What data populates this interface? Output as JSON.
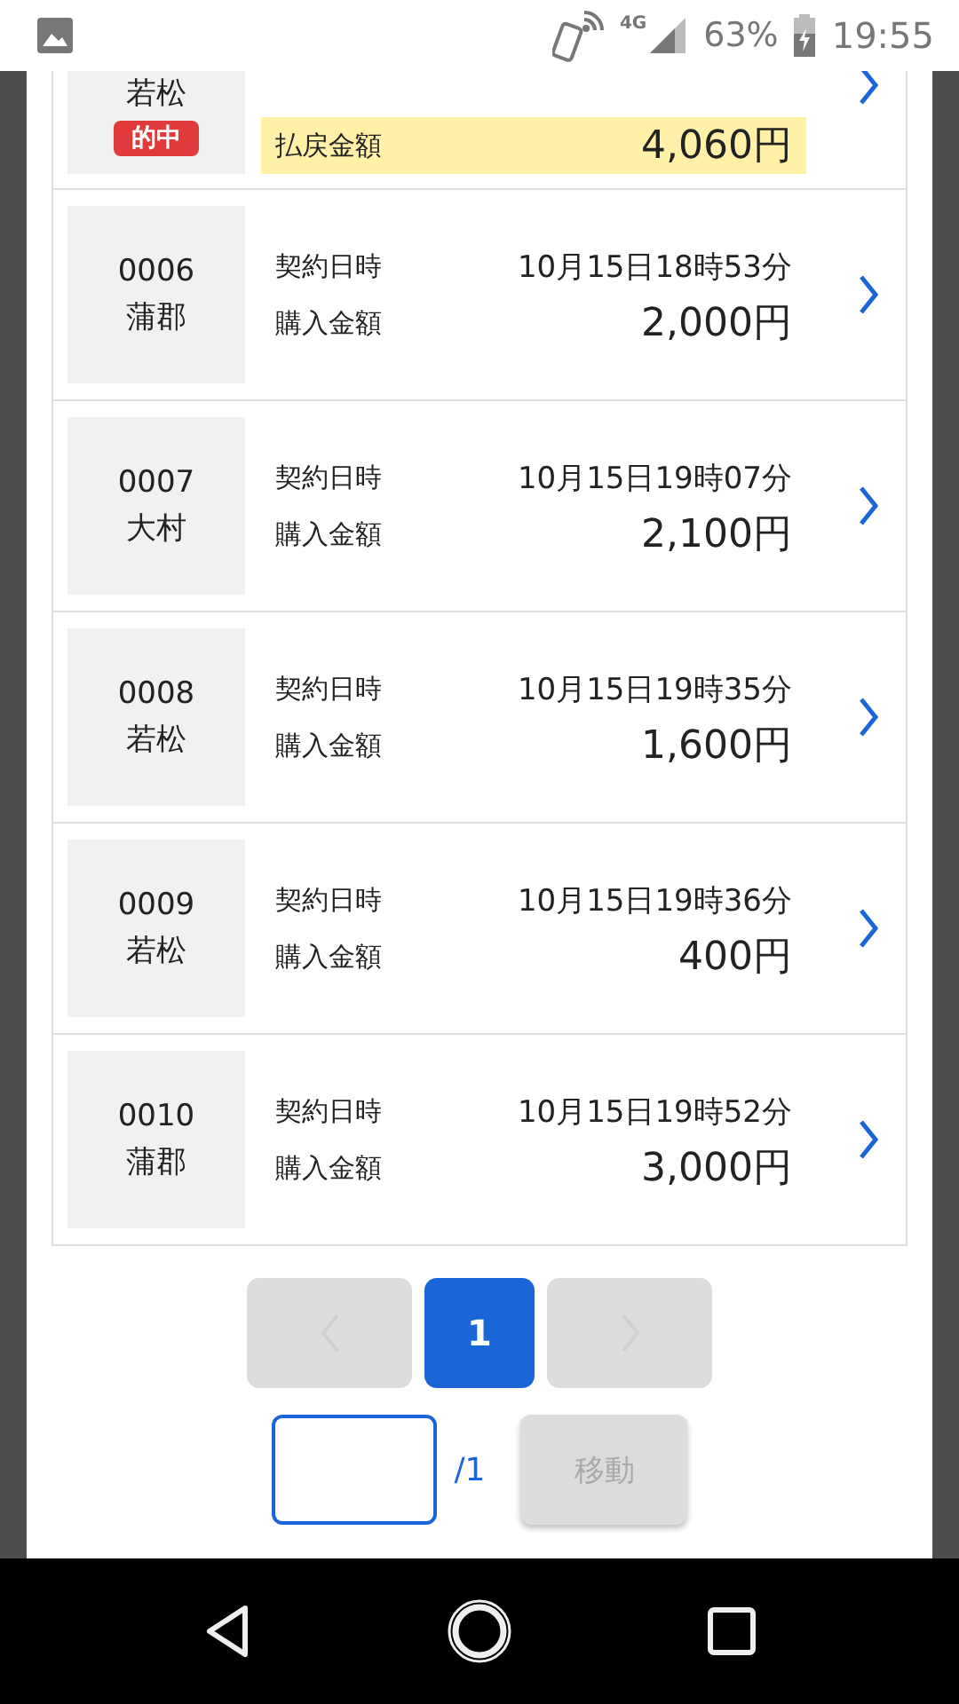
{
  "status_bar": {
    "network": "4G",
    "battery": "63%",
    "time": "19:55"
  },
  "entries": [
    {
      "kind": "partial",
      "venue": "若松",
      "hit": true,
      "hit_label": "的中",
      "payout_label": "払戻金額",
      "payout": "4,060円"
    },
    {
      "kind": "full",
      "number": "0006",
      "venue": "蒲郡",
      "hit": false,
      "date_label": "契約日時",
      "date": "10月15日18時53分",
      "amount_label": "購入金額",
      "amount": "2,000円"
    },
    {
      "kind": "full",
      "number": "0007",
      "venue": "大村",
      "hit": false,
      "date_label": "契約日時",
      "date": "10月15日19時07分",
      "amount_label": "購入金額",
      "amount": "2,100円"
    },
    {
      "kind": "full",
      "number": "0008",
      "venue": "若松",
      "hit": false,
      "date_label": "契約日時",
      "date": "10月15日19時35分",
      "amount_label": "購入金額",
      "amount": "1,600円"
    },
    {
      "kind": "full",
      "number": "0009",
      "venue": "若松",
      "hit": false,
      "date_label": "契約日時",
      "date": "10月15日19時36分",
      "amount_label": "購入金額",
      "amount": "400円"
    },
    {
      "kind": "full",
      "number": "0010",
      "venue": "蒲郡",
      "hit": false,
      "date_label": "契約日時",
      "date": "10月15日19時52分",
      "amount_label": "購入金額",
      "amount": "3,000円"
    }
  ],
  "pagination": {
    "prev_disabled": true,
    "pages": [
      {
        "label": "1",
        "selected": true
      }
    ],
    "next_disabled": true
  },
  "jump": {
    "total": "/1",
    "button": "移動",
    "button_disabled": true
  }
}
